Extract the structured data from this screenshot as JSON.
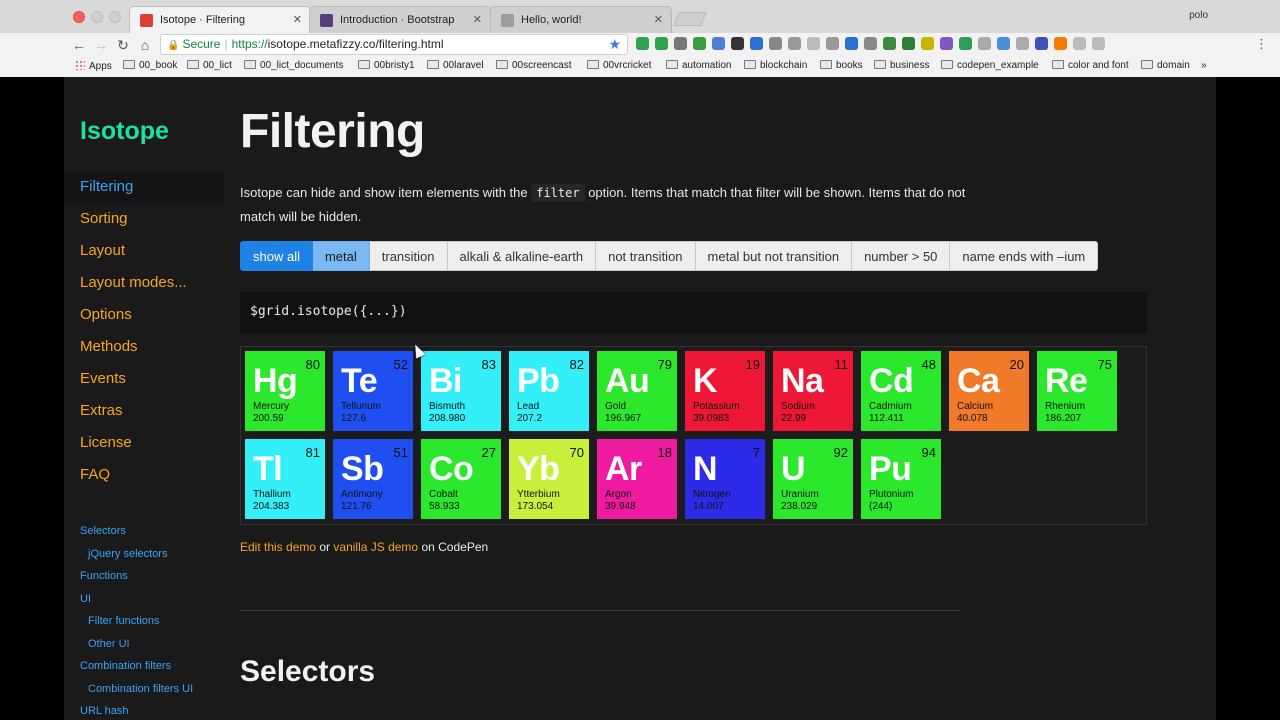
{
  "browser": {
    "tabs": [
      {
        "title": "Isotope · Filtering",
        "active": true,
        "favicon_color": "#d8412f"
      },
      {
        "title": "Introduction · Bootstrap",
        "active": false,
        "favicon_color": "#563d7c"
      },
      {
        "title": "Hello, world!",
        "active": false,
        "favicon_color": "#9e9e9e"
      }
    ],
    "profile": "polo",
    "secure_label": "Secure",
    "url_protocol": "https://",
    "url_rest": "isotope.metafizzy.co/filtering.html",
    "bookmarks": [
      "Apps",
      "00_book",
      "00_lict",
      "00_lict_documents",
      "00bristy1",
      "00laravel",
      "00screencast",
      "00vrcricket",
      "automation",
      "blockchain",
      "books",
      "business",
      "codepen_example",
      "color and font",
      "domain"
    ],
    "bookmarks_more": "»"
  },
  "sidebar": {
    "logo": "Isotope",
    "nav": [
      {
        "label": "Filtering",
        "active": true
      },
      {
        "label": "Sorting",
        "active": false
      },
      {
        "label": "Layout",
        "active": false
      },
      {
        "label": "Layout modes...",
        "active": false
      },
      {
        "label": "Options",
        "active": false
      },
      {
        "label": "Methods",
        "active": false
      },
      {
        "label": "Events",
        "active": false
      },
      {
        "label": "Extras",
        "active": false
      },
      {
        "label": "License",
        "active": false
      },
      {
        "label": "FAQ",
        "active": false
      }
    ],
    "subnav": [
      {
        "label": "Selectors",
        "indent": false
      },
      {
        "label": "jQuery selectors",
        "indent": true
      },
      {
        "label": "Functions",
        "indent": false
      },
      {
        "label": "UI",
        "indent": false
      },
      {
        "label": "Filter functions",
        "indent": true
      },
      {
        "label": "Other UI",
        "indent": true
      },
      {
        "label": "Combination filters",
        "indent": false
      },
      {
        "label": "Combination filters UI",
        "indent": true
      },
      {
        "label": "URL hash",
        "indent": false
      }
    ]
  },
  "main": {
    "title": "Filtering",
    "intro_before": "Isotope can hide and show item elements with the ",
    "intro_code": "filter",
    "intro_after": " option. Items that match that filter will be shown. Items that do not match will be hidden.",
    "filter_buttons": [
      {
        "label": "show all",
        "state": "checked"
      },
      {
        "label": "metal",
        "state": "hover"
      },
      {
        "label": "transition",
        "state": "normal"
      },
      {
        "label": "alkali & alkaline-earth",
        "state": "normal"
      },
      {
        "label": "not transition",
        "state": "normal"
      },
      {
        "label": "metal but not transition",
        "state": "normal"
      },
      {
        "label": "number > 50",
        "state": "normal"
      },
      {
        "label": "name ends with –ium",
        "state": "normal"
      }
    ],
    "code": "$grid.isotope({...})",
    "elements": [
      {
        "symbol": "Hg",
        "number": "80",
        "name": "Mercury",
        "weight": "200.59",
        "color": "#2ce82c"
      },
      {
        "symbol": "Te",
        "number": "52",
        "name": "Tellurium",
        "weight": "127.6",
        "color": "#1f4ff0"
      },
      {
        "symbol": "Bi",
        "number": "83",
        "name": "Bismuth",
        "weight": "208.980",
        "color": "#33f0f8"
      },
      {
        "symbol": "Pb",
        "number": "82",
        "name": "Lead",
        "weight": "207.2",
        "color": "#33f0f8"
      },
      {
        "symbol": "Au",
        "number": "79",
        "name": "Gold",
        "weight": "196.967",
        "color": "#2ce82c"
      },
      {
        "symbol": "K",
        "number": "19",
        "name": "Potassium",
        "weight": "39.0983",
        "color": "#ee1736"
      },
      {
        "symbol": "Na",
        "number": "11",
        "name": "Sodium",
        "weight": "22.99",
        "color": "#ee1736"
      },
      {
        "symbol": "Cd",
        "number": "48",
        "name": "Cadmium",
        "weight": "112.411",
        "color": "#2ce82c"
      },
      {
        "symbol": "Ca",
        "number": "20",
        "name": "Calcium",
        "weight": "40.078",
        "color": "#f07a2a"
      },
      {
        "symbol": "Re",
        "number": "75",
        "name": "Rhenium",
        "weight": "186.207",
        "color": "#2ce82c"
      },
      {
        "symbol": "Tl",
        "number": "81",
        "name": "Thallium",
        "weight": "204.383",
        "color": "#33f0f8"
      },
      {
        "symbol": "Sb",
        "number": "51",
        "name": "Antimony",
        "weight": "121.76",
        "color": "#1f4ff0"
      },
      {
        "symbol": "Co",
        "number": "27",
        "name": "Cobalt",
        "weight": "58.933",
        "color": "#2ce82c"
      },
      {
        "symbol": "Yb",
        "number": "70",
        "name": "Ytterbium",
        "weight": "173.054",
        "color": "#c8f03a"
      },
      {
        "symbol": "Ar",
        "number": "18",
        "name": "Argon",
        "weight": "39.948",
        "color": "#ee1aa0"
      },
      {
        "symbol": "N",
        "number": "7",
        "name": "Nitrogen",
        "weight": "14.007",
        "color": "#2b2be8"
      },
      {
        "symbol": "U",
        "number": "92",
        "name": "Uranium",
        "weight": "238.029",
        "color": "#2ce82c"
      },
      {
        "symbol": "Pu",
        "number": "94",
        "name": "Plutonium",
        "weight": "(244)",
        "color": "#2ce82c"
      }
    ],
    "edit_link": "Edit this demo",
    "or_text": " or ",
    "vanilla_link": "vanilla JS demo",
    "on_text": " on CodePen",
    "section_title": "Selectors"
  },
  "colors": {
    "accent_blue": "#1f82e5",
    "nav_orange": "#f5a623",
    "logo_teal": "#1de0a4",
    "page_bg": "#1a1a1a"
  }
}
